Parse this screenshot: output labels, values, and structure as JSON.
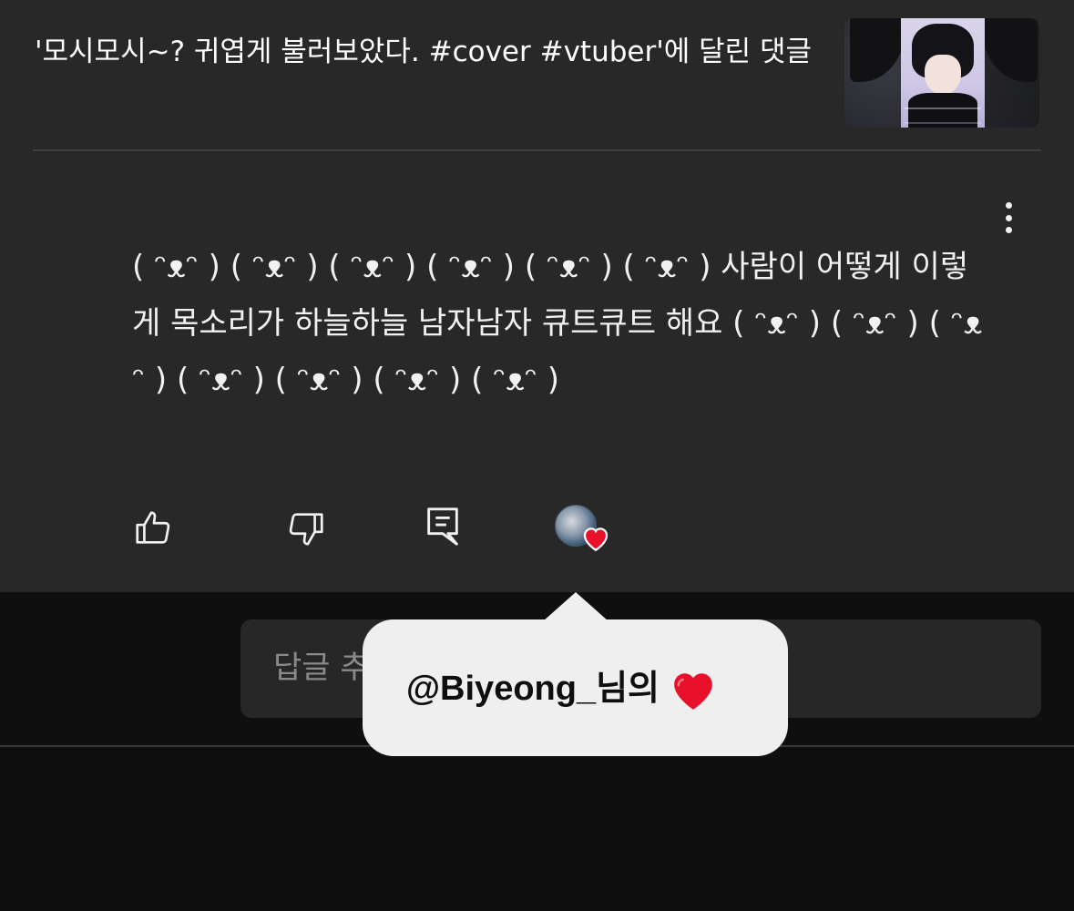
{
  "header": {
    "title": "'모시모시~? 귀엽게 불러보았다. #cover #vtuber'에 달린 댓글",
    "thumbnail": "video-thumbnail-vtuber-character"
  },
  "comment": {
    "text": "( ᵔᴥᵔ ) ( ᵔᴥᵔ ) ( ᵔᴥᵔ ) ( ᵔᴥᵔ ) ( ᵔᴥᵔ ) ( ᵔᴥᵔ ) 사람이 어떻게 이렇게 목소리가 하늘하늘 남자남자 큐트큐트 해요 ( ᵔᴥᵔ ) ( ᵔᴥᵔ ) ( ᵔᴥᵔ ) ( ᵔᴥᵔ ) ( ᵔᴥᵔ ) ( ᵔᴥᵔ ) ( ᵔᴥᵔ )",
    "more_icon": "more-vertical-icon"
  },
  "actions": {
    "like_icon": "thumbs-up-icon",
    "dislike_icon": "thumbs-down-icon",
    "reply_icon": "comment-reply-icon",
    "creator_heart_icon": "creator-heart-icon"
  },
  "reply": {
    "placeholder": "답글 추가..."
  },
  "tooltip": {
    "text": "@Biyeong_님의"
  },
  "colors": {
    "card_bg": "#282828",
    "page_bg": "#0f0f0f",
    "heart": "#e8102b",
    "tooltip_bg": "#efefef"
  }
}
